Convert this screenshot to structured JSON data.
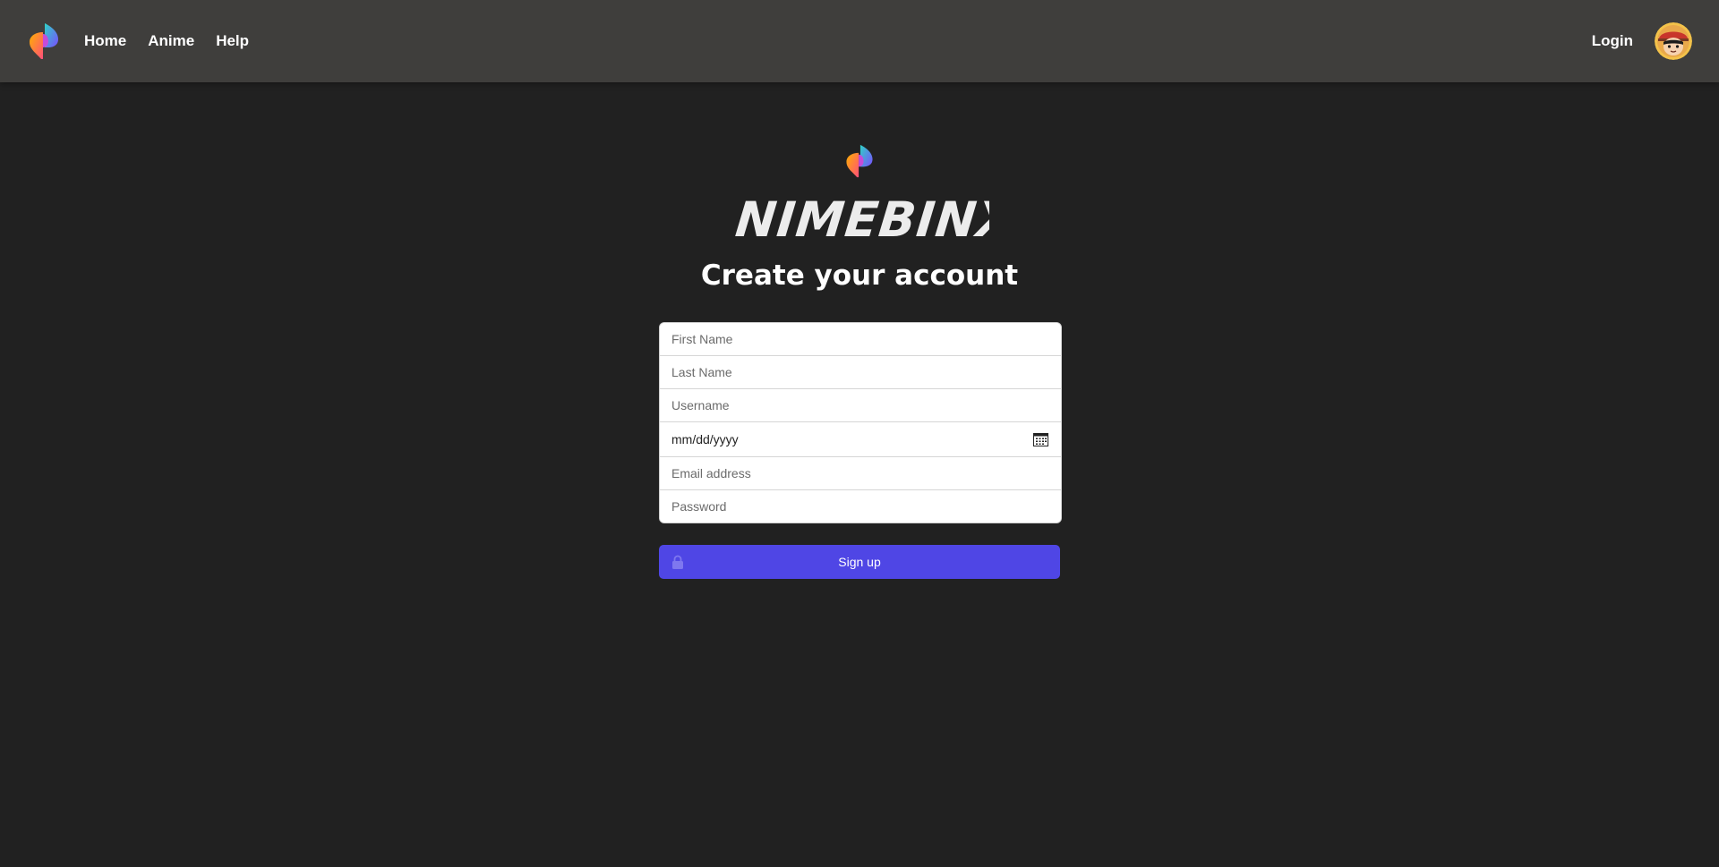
{
  "nav": {
    "items": [
      {
        "label": "Home"
      },
      {
        "label": "Anime"
      },
      {
        "label": "Help"
      }
    ],
    "login_label": "Login",
    "logo_icon": "brand-logo-icon",
    "avatar_icon": "user-avatar"
  },
  "main": {
    "wordmark": "ANIMEBINX",
    "heading": "Create your account"
  },
  "form": {
    "first_name": {
      "placeholder": "First Name",
      "value": ""
    },
    "last_name": {
      "placeholder": "Last Name",
      "value": ""
    },
    "username": {
      "placeholder": "Username",
      "value": ""
    },
    "birthdate": {
      "display": "mm/dd/yyyy",
      "icon": "calendar-icon"
    },
    "email": {
      "placeholder": "Email address",
      "value": ""
    },
    "password": {
      "placeholder": "Password",
      "value": ""
    }
  },
  "signup_button": {
    "label": "Sign up",
    "icon": "lock-icon"
  },
  "colors": {
    "background": "#212121",
    "topbar": "#3f3e3c",
    "accent": "#4f46e5"
  }
}
